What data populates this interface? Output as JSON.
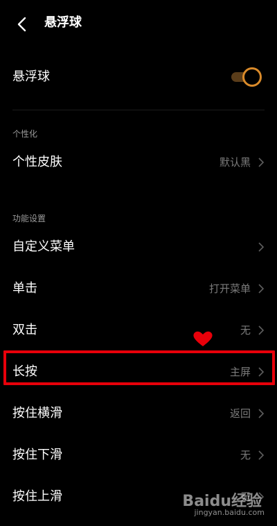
{
  "header": {
    "title": "悬浮球"
  },
  "toggle_row": {
    "label": "悬浮球",
    "enabled": true
  },
  "sections": {
    "personalize": "个性化",
    "function_settings": "功能设置"
  },
  "personalize_items": [
    {
      "label": "个性皮肤",
      "value": "默认黑"
    }
  ],
  "function_items": [
    {
      "label": "自定义菜单",
      "value": ""
    },
    {
      "label": "单击",
      "value": "打开菜单"
    },
    {
      "label": "双击",
      "value": "无"
    },
    {
      "label": "长按",
      "value": "主屏"
    },
    {
      "label": "按住横滑",
      "value": "返回"
    },
    {
      "label": "按住下滑",
      "value": "无"
    },
    {
      "label": "按住上滑",
      "value": "无"
    }
  ],
  "watermark": {
    "brand": "Baidu经验",
    "url": "jingyan.baidu.com"
  },
  "colors": {
    "accent": "#d98a2a",
    "highlight": "#e8000a",
    "background": "#000000"
  }
}
